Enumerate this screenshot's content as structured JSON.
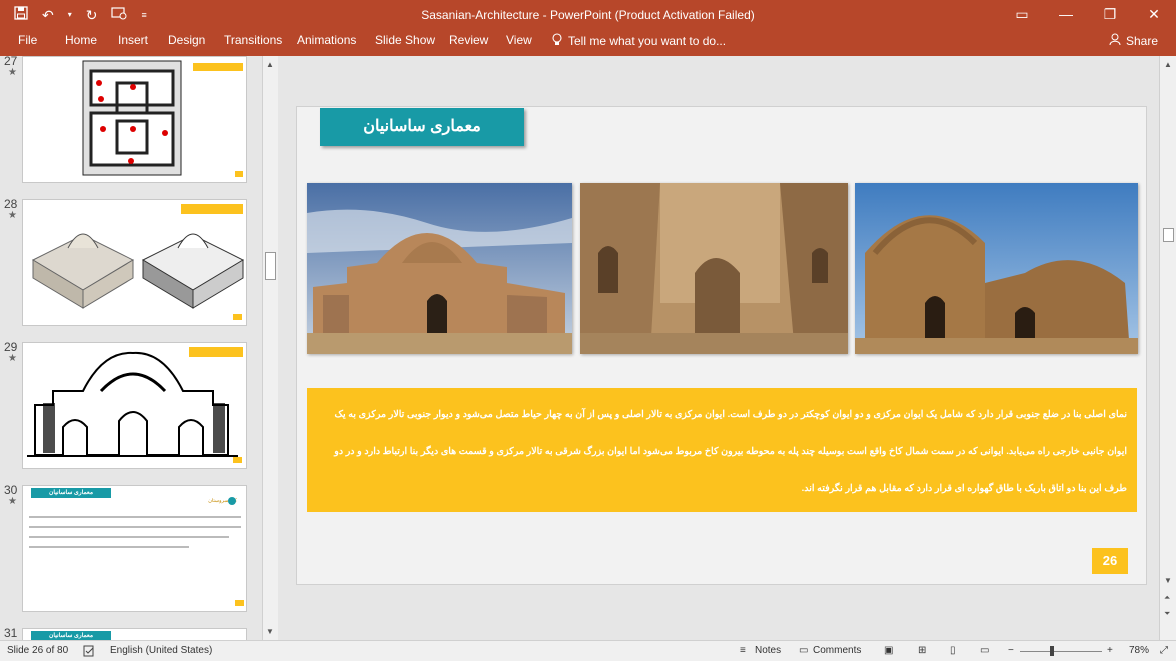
{
  "window": {
    "title": "Sasanian-Architecture - PowerPoint (Product Activation Failed)"
  },
  "quick_access": {
    "save_icon": "save-icon",
    "undo_icon": "undo-icon",
    "redo_icon": "redo-icon",
    "present_icon": "present-from-start-icon",
    "customize_icon": "customize-icon"
  },
  "ribbon": {
    "tabs": [
      "File",
      "Home",
      "Insert",
      "Design",
      "Transitions",
      "Animations",
      "Slide Show",
      "Review",
      "View"
    ],
    "tell_me": "Tell me what you want to do...",
    "share": "Share"
  },
  "thumbnails": [
    {
      "number": "27",
      "star": "★"
    },
    {
      "number": "28",
      "star": "★"
    },
    {
      "number": "29",
      "star": "★"
    },
    {
      "number": "30",
      "star": "★",
      "title": "معماری ساسانیان",
      "item": "کاخ سروستان"
    },
    {
      "number": "31",
      "title": "معماری ساسانیان"
    }
  ],
  "slide": {
    "title": "معماری ساسانیان",
    "body": "نمای اصلی بنا در ضلع جنوبی قرار دارد که شامل یک ایوان مرکزی و دو ایوان کوچکتر در دو طرف است. ایوان مرکزی به تالار اصلی و پس از آن به چهار حیاط متصل می‌شود و دیوار جنوبی تالار مرکزی به یک ایوان جانبی خارجی راه می‌یابد. ایوانی که در سمت شمال کاخ واقع است بوسیله چند پله به محوطه بیرون کاخ مربوط می‌شود اما ایوان بزرگ شرقی به تالار مرکزی و قسمت های دیگر بنا ارتباط دارد و در دو طرف این بنا دو اتاق باریک با طاق گهواره ای قرار دارد که مقابل هم قرار نگرفته اند.",
    "number": "26"
  },
  "status": {
    "slide_info": "Slide 26 of 80",
    "language": "English (United States)",
    "notes": "Notes",
    "comments": "Comments",
    "zoom": "78%"
  },
  "colors": {
    "accent": "#b7472a",
    "teal": "#189aa6",
    "yellow": "#fcc21e"
  }
}
